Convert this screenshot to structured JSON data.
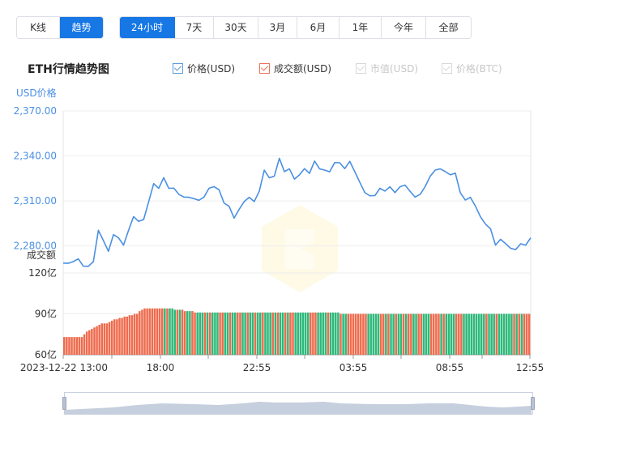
{
  "mode_tabs": [
    {
      "label": "K线",
      "active": false
    },
    {
      "label": "趋势",
      "active": true
    }
  ],
  "range_tabs": [
    {
      "label": "24小时",
      "active": true
    },
    {
      "label": "7天",
      "active": false
    },
    {
      "label": "30天",
      "active": false
    },
    {
      "label": "3月",
      "active": false
    },
    {
      "label": "6月",
      "active": false
    },
    {
      "label": "1年",
      "active": false
    },
    {
      "label": "今年",
      "active": false
    },
    {
      "label": "全部",
      "active": false
    }
  ],
  "chart_title": "ETH行情趋势图",
  "legend": [
    {
      "label": "价格(USD)",
      "checked": true,
      "color": "#4a90e2"
    },
    {
      "label": "成交额(USD)",
      "checked": true,
      "color": "#e8735a"
    },
    {
      "label": "市值(USD)",
      "checked": false,
      "color": "#d8d8d8"
    },
    {
      "label": "价格(BTC)",
      "checked": false,
      "color": "#d8d8d8"
    }
  ],
  "colors": {
    "accent": "#1677e5",
    "price_line": "#4a90e2",
    "volume_up": "#2eb87a",
    "volume_down": "#ef6b4d",
    "axis_label": "#4a90e2"
  },
  "chart_data": {
    "type": "line",
    "price_axis_label": "USD价格",
    "volume_axis_label": "成交额",
    "price_ticks": [
      "2,370.00",
      "2,340.00",
      "2,310.00",
      "2,280.00"
    ],
    "price_tick_values": [
      2370,
      2340,
      2310,
      2280
    ],
    "volume_ticks": [
      "120亿",
      "90亿",
      "60亿"
    ],
    "volume_tick_values": [
      120,
      90,
      60
    ],
    "x_ticks": [
      "2023-12-22 13:00",
      "18:00",
      "22:55",
      "03:55",
      "08:55",
      "12:55"
    ],
    "price_ylim": [
      2262,
      2370
    ],
    "volume_ylim": [
      60,
      120
    ],
    "grid": true,
    "series": [
      {
        "name": "价格(USD)",
        "values": [
          2269,
          2268,
          2270,
          2271,
          2267,
          2266,
          2270,
          2290,
          2284,
          2276,
          2288,
          2285,
          2281,
          2290,
          2300,
          2296,
          2298,
          2309,
          2322,
          2318,
          2326,
          2318,
          2319,
          2314,
          2313,
          2312,
          2312,
          2310,
          2313,
          2318,
          2320,
          2317,
          2309,
          2306,
          2299,
          2304,
          2310,
          2312,
          2310,
          2316,
          2331,
          2325,
          2327,
          2338,
          2330,
          2331,
          2325,
          2327,
          2332,
          2328,
          2337,
          2331,
          2331,
          2329,
          2336,
          2335,
          2332,
          2336,
          2330,
          2322,
          2316,
          2313,
          2314,
          2318,
          2317,
          2319,
          2316,
          2319,
          2321,
          2316,
          2313,
          2314,
          2320,
          2326,
          2331,
          2331,
          2330,
          2327,
          2329,
          2315,
          2311,
          2312,
          2307,
          2299,
          2295,
          2291,
          2281,
          2284,
          2282,
          2278,
          2278,
          2281,
          2281,
          2285
        ]
      },
      {
        "name": "成交额(USD)",
        "values": [
          73,
          73,
          73,
          73,
          73,
          73,
          73,
          73,
          75,
          77,
          78,
          79,
          80,
          81,
          82,
          83,
          83,
          83,
          84,
          85,
          86,
          86,
          87,
          87,
          88,
          88,
          89,
          89,
          90,
          90,
          92,
          93,
          94,
          94,
          94,
          94,
          94,
          94,
          94,
          94,
          94,
          94,
          94,
          94,
          93,
          93,
          93,
          93,
          92,
          92,
          92,
          92,
          91,
          91,
          91,
          91,
          91,
          91,
          91,
          91,
          91,
          91,
          91,
          91,
          91,
          91,
          91,
          91,
          91,
          91,
          91,
          91,
          91,
          91,
          91,
          91,
          91,
          91,
          91,
          91,
          91,
          91,
          91,
          91,
          91,
          91,
          91,
          91,
          91,
          91,
          91,
          91,
          91,
          91,
          91,
          91,
          91,
          91,
          91,
          91,
          91,
          91,
          91,
          91,
          91,
          91,
          91,
          91,
          91,
          91,
          90,
          90,
          90,
          90,
          90,
          90,
          90,
          90,
          90,
          90,
          90,
          90,
          90,
          90,
          90,
          90,
          90,
          90,
          90,
          90,
          90,
          90,
          90,
          90,
          90,
          90,
          90,
          90,
          90,
          90,
          90,
          90,
          90,
          90,
          90,
          90,
          90,
          90,
          90,
          90,
          90,
          90,
          90,
          90,
          90,
          90,
          90,
          90,
          90,
          90,
          90,
          90,
          90,
          90,
          90,
          90,
          90,
          90,
          90,
          90,
          90,
          90,
          90,
          90,
          90,
          90,
          90,
          90,
          90,
          90,
          90,
          90,
          90,
          90,
          90,
          90
        ]
      }
    ]
  }
}
